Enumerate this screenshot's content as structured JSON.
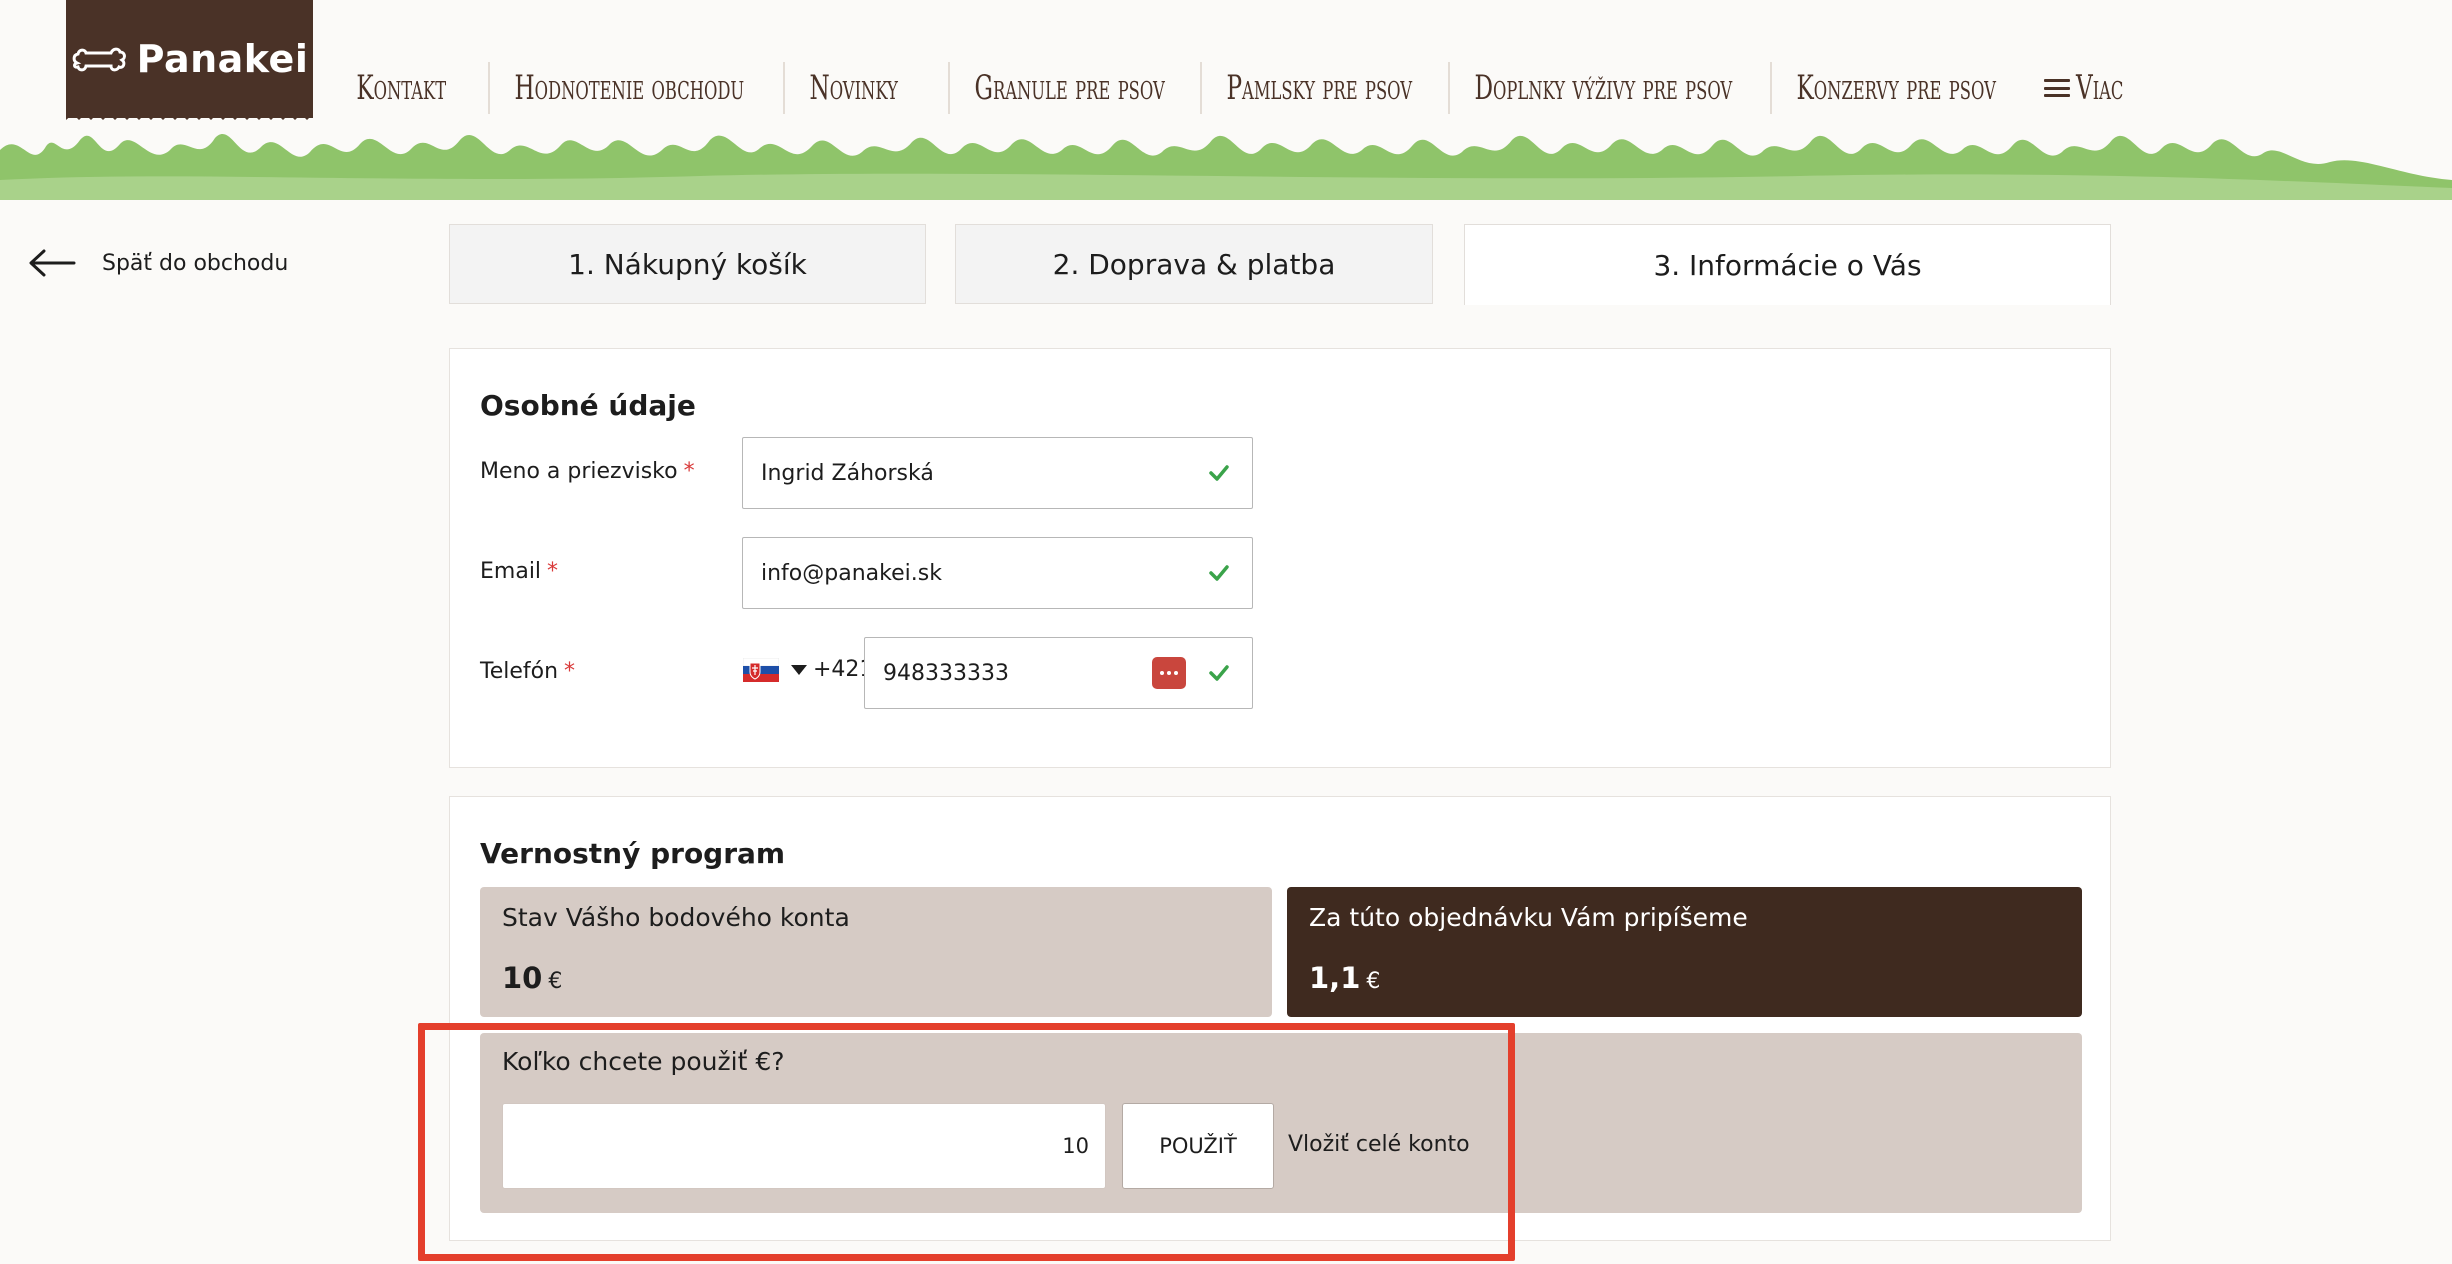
{
  "brand": {
    "logo_text": "Panakei",
    "logo_color": "#4a3227"
  },
  "nav": {
    "items": [
      "Kontakt",
      "Hodnotenie obchodu",
      "Novinky",
      "Granule pre psov",
      "Pamlsky pre psov",
      "Doplnky výživy pre psov",
      "Konzervy pre psov"
    ],
    "more_label": "Viac"
  },
  "back_label": "Späť do obchodu",
  "steps": [
    {
      "label": "1. Nákupný košík"
    },
    {
      "label": "2. Doprava & platba"
    },
    {
      "label": "3. Informácie o Vás",
      "active": true
    }
  ],
  "personal": {
    "title": "Osobné údaje",
    "required_mark": "*",
    "name": {
      "label": "Meno a priezvisko",
      "value": "Ingrid Záhorská"
    },
    "email": {
      "label": "Email",
      "value": "info@panakei.sk"
    },
    "phone": {
      "label": "Telefón",
      "prefix": "+421",
      "value": "948333333"
    }
  },
  "loyalty": {
    "title": "Vernostný program",
    "balance": {
      "label": "Stav Vášho bodového konta",
      "value": "10",
      "currency": "€"
    },
    "earn": {
      "label": "Za túto objednávku Vám pripíšeme",
      "value": "1,1",
      "currency": "€"
    },
    "use": {
      "label": "Koľko chcete použiť €?",
      "amount": "10",
      "apply_label": "POUŽIŤ",
      "all_label": "Vložiť celé konto"
    }
  },
  "colors": {
    "accent_brown": "#4a3227",
    "dark_box": "#3f2a1f",
    "light_box": "#d6cbc5",
    "grass": "#8fc46a",
    "check_green": "#3aa34a",
    "required_red": "#d93a3a",
    "highlight_red": "#e43f2c"
  }
}
